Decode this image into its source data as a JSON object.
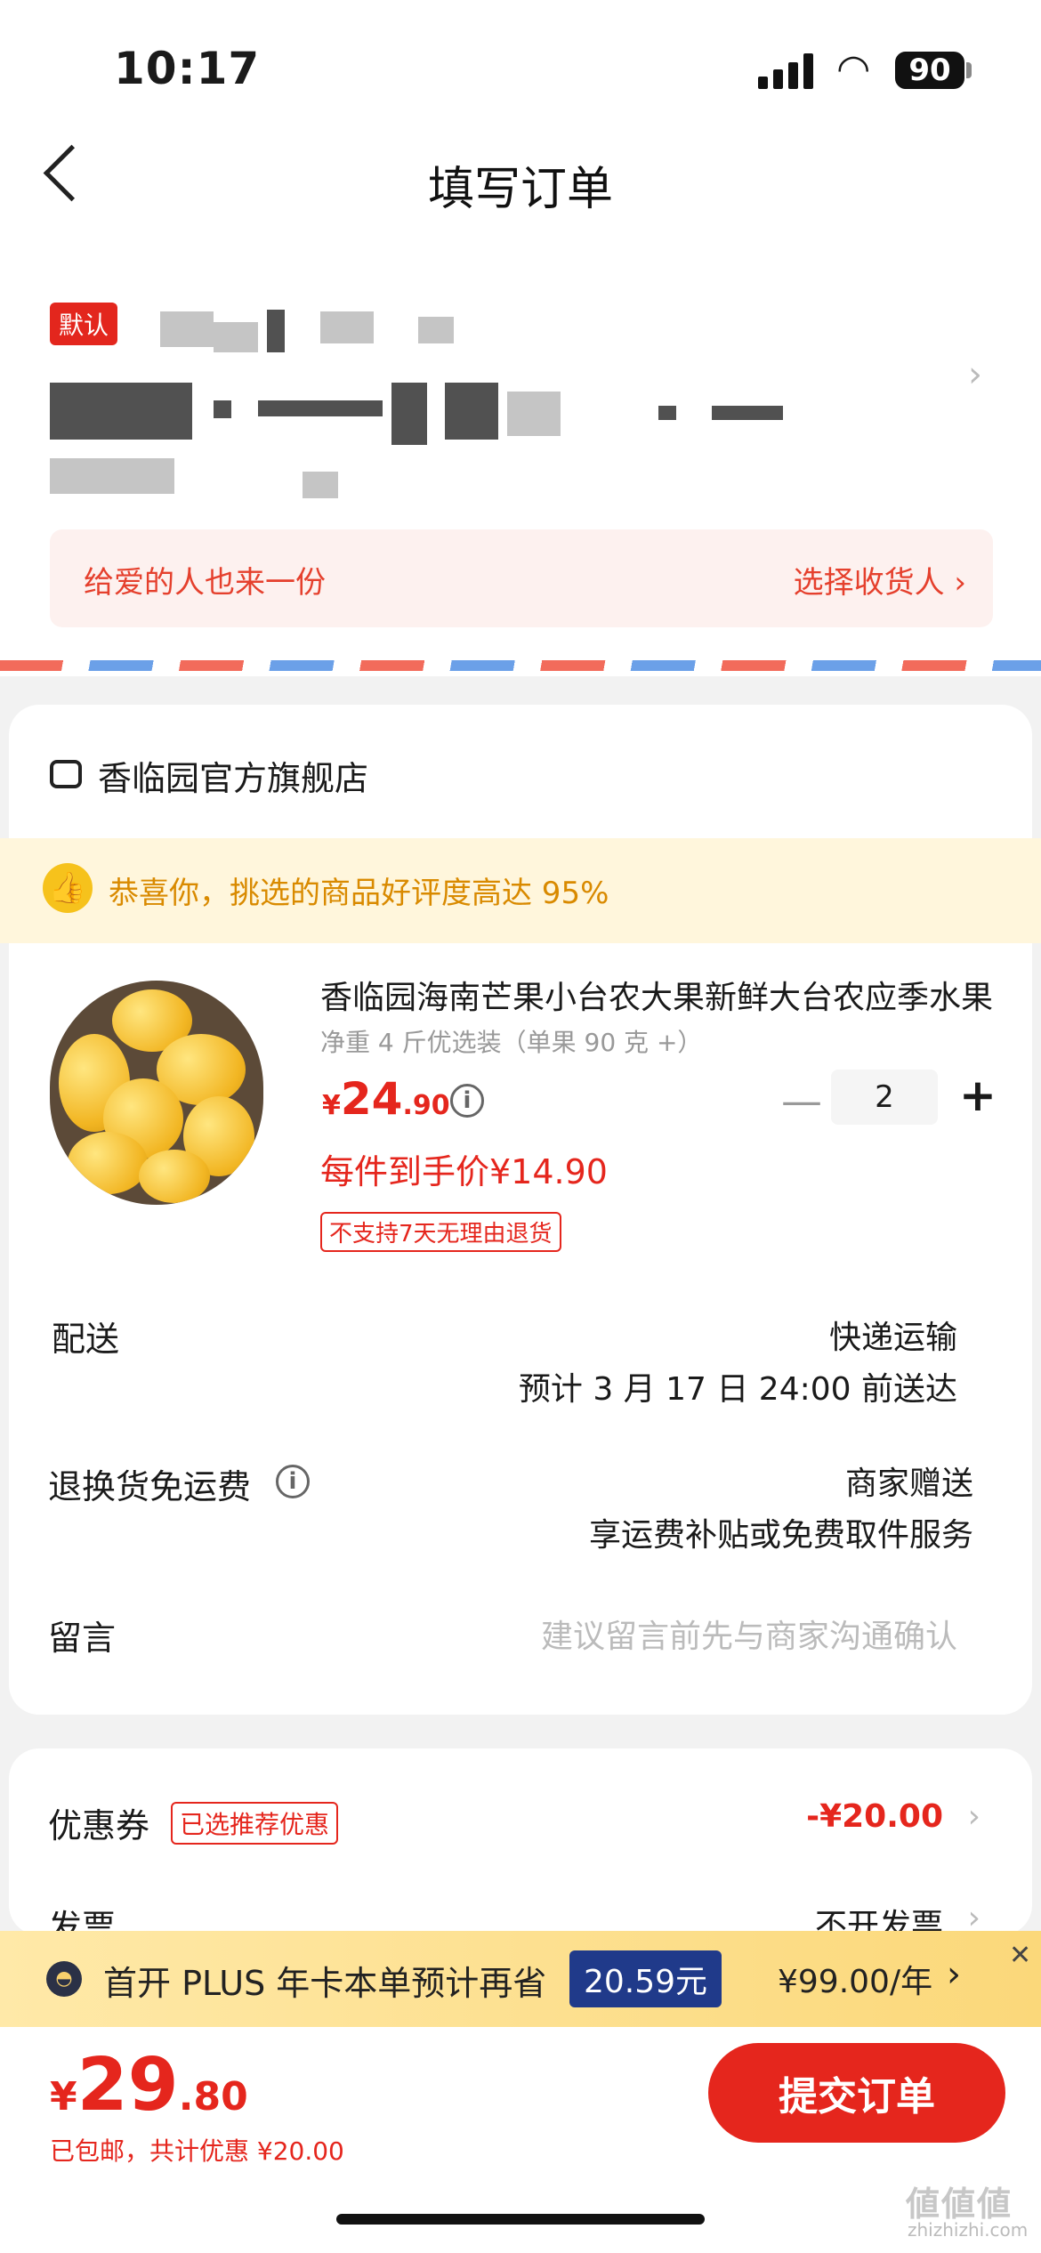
{
  "status_bar": {
    "time": "10:17",
    "battery": "90"
  },
  "header": {
    "title": "填写订单"
  },
  "address": {
    "default_badge": "默认",
    "gift_text": "给爱的人也来一份",
    "choose_receiver": "选择收货人 ›"
  },
  "store": {
    "name": "香临园官方旗舰店",
    "banner": "恭喜你，挑选的商品好评度高达 95%",
    "product": {
      "name": "香临园海南芒果小台农大果新鲜大台农应季水果",
      "spec": "净重 4 斤优选装（单果 90 克 +）",
      "price_symbol": "¥",
      "price_int": "24",
      "price_dec": ".90",
      "quantity": "2",
      "deal_price": "每件到手价¥14.90",
      "return_policy": "不支持7天无理由退货"
    },
    "delivery": {
      "label": "配送",
      "method": "快递运输",
      "eta": "预计 3 月 17 日 24:00 前送达"
    },
    "return_shipping": {
      "label": "退换货免运费",
      "value": "商家赠送",
      "detail": "享运费补贴或免费取件服务"
    },
    "message": {
      "label": "留言",
      "placeholder": "建议留言前先与商家沟通确认"
    }
  },
  "discounts": {
    "coupon_label": "优惠券",
    "coupon_tag": "已选推荐优惠",
    "coupon_value": "-¥20.00",
    "invoice_label": "发票",
    "invoice_value": "不开发票"
  },
  "plus_bar": {
    "text": "首开 PLUS 年卡本单预计再省",
    "amount": "20.59元",
    "price": "¥99.00/年"
  },
  "footer": {
    "total_symbol": "¥",
    "total_int": "29",
    "total_dec": ".80",
    "summary": "已包邮，共计优惠 ¥20.00",
    "submit_label": "提交订单"
  },
  "watermark": {
    "site": "zhizhizhi.com"
  },
  "colors": {
    "accent": "#e5261d",
    "banner": "#fff6dc",
    "plus_amount_bg": "#203a8a"
  }
}
